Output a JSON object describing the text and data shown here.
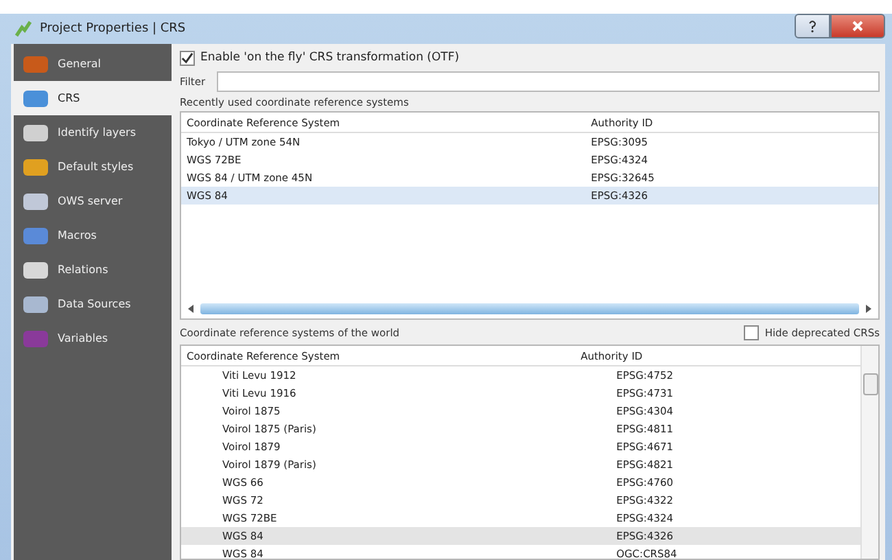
{
  "window": {
    "title": "Project Properties | CRS"
  },
  "sidebar": {
    "items": [
      {
        "label": "General",
        "selected": false
      },
      {
        "label": "CRS",
        "selected": true
      },
      {
        "label": "Identify layers",
        "selected": false
      },
      {
        "label": "Default styles",
        "selected": false
      },
      {
        "label": "OWS server",
        "selected": false
      },
      {
        "label": "Macros",
        "selected": false
      },
      {
        "label": "Relations",
        "selected": false
      },
      {
        "label": "Data Sources",
        "selected": false
      },
      {
        "label": "Variables",
        "selected": false
      }
    ]
  },
  "otf": {
    "label": "Enable 'on the fly' CRS transformation (OTF)",
    "checked": true
  },
  "filter": {
    "label": "Filter"
  },
  "recent": {
    "title": "Recently used coordinate reference systems",
    "columns": [
      "Coordinate Reference System",
      "Authority ID"
    ],
    "rows": [
      {
        "name": "Tokyo / UTM zone 54N",
        "id": "EPSG:3095",
        "selected": false
      },
      {
        "name": "WGS 72BE",
        "id": "EPSG:4324",
        "selected": false
      },
      {
        "name": "WGS 84 / UTM zone 45N",
        "id": "EPSG:32645",
        "selected": false
      },
      {
        "name": "WGS 84",
        "id": "EPSG:4326",
        "selected": true
      }
    ]
  },
  "world": {
    "title": "Coordinate reference systems of the world",
    "hide_deprecated": {
      "label": "Hide deprecated CRSs",
      "checked": false
    },
    "columns": [
      "Coordinate Reference System",
      "Authority ID"
    ],
    "rows": [
      {
        "name": "Viti Levu 1912",
        "id": "EPSG:4752",
        "selected": false
      },
      {
        "name": "Viti Levu 1916",
        "id": "EPSG:4731",
        "selected": false
      },
      {
        "name": "Voirol 1875",
        "id": "EPSG:4304",
        "selected": false
      },
      {
        "name": "Voirol 1875 (Paris)",
        "id": "EPSG:4811",
        "selected": false
      },
      {
        "name": "Voirol 1879",
        "id": "EPSG:4671",
        "selected": false
      },
      {
        "name": "Voirol 1879 (Paris)",
        "id": "EPSG:4821",
        "selected": false
      },
      {
        "name": "WGS 66",
        "id": "EPSG:4760",
        "selected": false
      },
      {
        "name": "WGS 72",
        "id": "EPSG:4322",
        "selected": false
      },
      {
        "name": "WGS 72BE",
        "id": "EPSG:4324",
        "selected": false
      },
      {
        "name": "WGS 84",
        "id": "EPSG:4326",
        "selected": true
      },
      {
        "name": "WGS 84",
        "id": "OGC:CRS84",
        "selected": false
      }
    ]
  }
}
